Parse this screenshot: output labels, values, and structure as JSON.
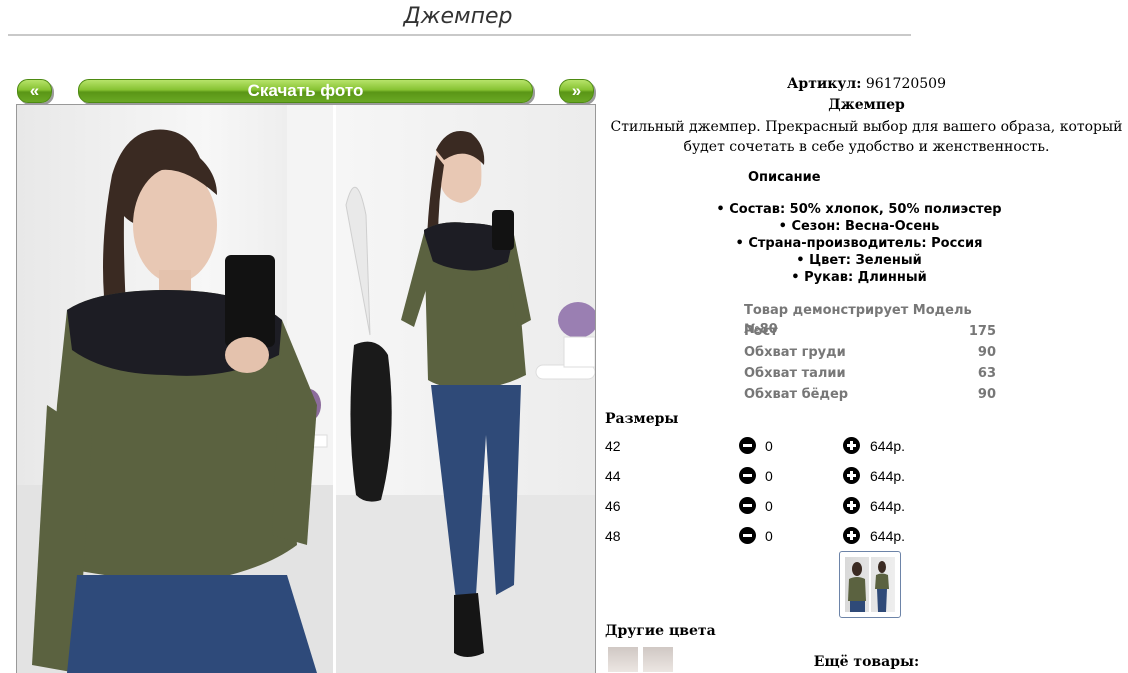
{
  "page": {
    "title": "Джемпер"
  },
  "gallery": {
    "prev_label": "«",
    "download_label": "Скачать фото",
    "next_label": "»"
  },
  "product": {
    "sku_label": "Артикул:",
    "sku_value": "961720509",
    "name": "Джемпер",
    "description": "Стильный джемпер. Прекрасный выбор для вашего образа, который будет сочетать в себе удобство и женственность."
  },
  "description_section": {
    "heading": "Описание",
    "attributes": [
      "Состав: 50% хлопок, 50% полиэстер",
      "Сезон: Весна-Осень",
      "Страна-производитель: Россия",
      "Цвет: Зеленый",
      "Рукав: Длинный"
    ]
  },
  "model": {
    "title": "Товар демонстрирует Модель №80",
    "rows": [
      {
        "label": "Рост",
        "value": "175"
      },
      {
        "label": "Обхват груди",
        "value": "90"
      },
      {
        "label": "Обхват талии",
        "value": "63"
      },
      {
        "label": "Обхват бёдер",
        "value": "90"
      }
    ]
  },
  "sizes": {
    "heading": "Размеры",
    "rows": [
      {
        "size": "42",
        "qty": "0",
        "price": "644р."
      },
      {
        "size": "44",
        "qty": "0",
        "price": "644р."
      },
      {
        "size": "46",
        "qty": "0",
        "price": "644р."
      },
      {
        "size": "48",
        "qty": "0",
        "price": "644р."
      }
    ]
  },
  "other_colors": {
    "heading": "Другие цвета"
  },
  "more_products": {
    "heading": "Ещё товары:"
  },
  "icons": {
    "decrease": "minus-circle-icon",
    "increase": "plus-circle-icon"
  },
  "colors": {
    "button_green": "#6aa824",
    "model_text": "#777777"
  }
}
